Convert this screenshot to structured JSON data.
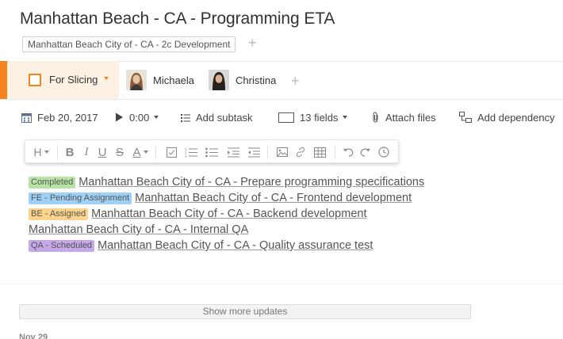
{
  "task": {
    "title": "Manhattan Beach - CA - Programming ETA",
    "folder_chip": "Manhattan Beach City of - CA - 2c Development",
    "add_folder": "+"
  },
  "status": {
    "label": "For Slicing",
    "accent_color": "#f5831f",
    "bg_color": "#fdf1e3"
  },
  "assignees": [
    {
      "name": "Michaela"
    },
    {
      "name": "Christina"
    }
  ],
  "add_assignee": "+",
  "toolbar": {
    "date": "Feb 20, 2017",
    "time": "0:00",
    "add_subtask": "Add subtask",
    "fields": "13 fields",
    "attach_files": "Attach files",
    "add_dependency": "Add dependency"
  },
  "editor_toolbar": {
    "heading": "H",
    "bold": "B",
    "italic": "I",
    "underline": "U",
    "strikethrough": "S",
    "text_color": "A"
  },
  "subtasks": [
    {
      "badge": "Completed",
      "badge_color": "#b7e3a4",
      "title": "Manhattan Beach City of - CA - Prepare programming specifications"
    },
    {
      "badge": "FE - Pending Assignment",
      "badge_color": "#9fd0f5",
      "title": "Manhattan Beach City of - CA - Frontend development"
    },
    {
      "badge": "BE - Assigned",
      "badge_color": "#fbd38a",
      "title": "Manhattan Beach City of - CA - Backend development"
    },
    {
      "badge": "",
      "badge_color": "",
      "title": "Manhattan Beach City of - CA - Internal QA"
    },
    {
      "badge": "QA - Scheduled",
      "badge_color": "#c4a8e8",
      "title": "Manhattan Beach City of - CA - Quality assurance test"
    }
  ],
  "show_more": "Show more updates",
  "date_header": "Nov 29"
}
